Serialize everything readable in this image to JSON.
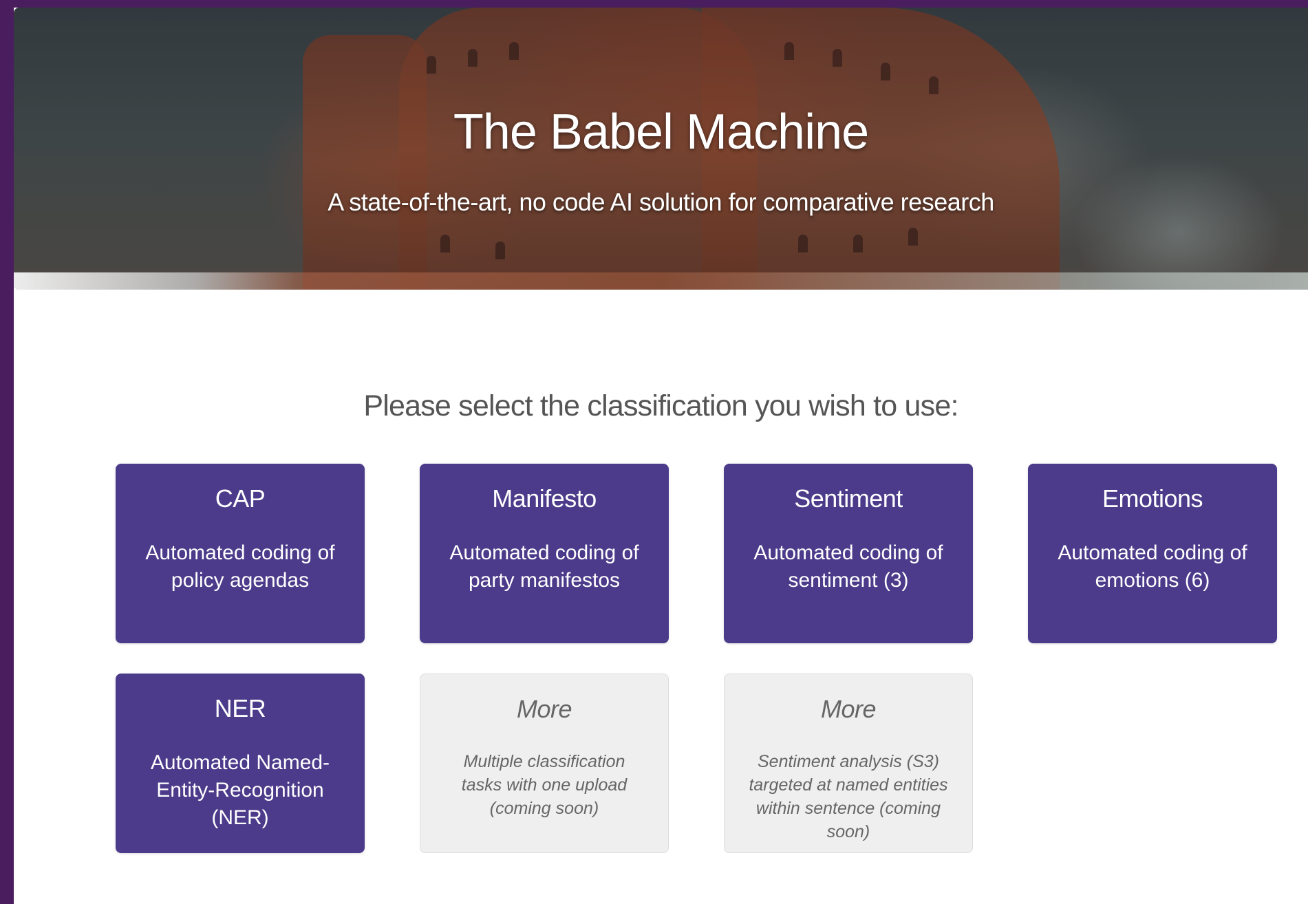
{
  "hero": {
    "title": "The Babel Machine",
    "subtitle": "A state-of-the-art, no code AI solution for comparative research"
  },
  "prompt": "Please select the classification you wish to use:",
  "cards": [
    {
      "title": "CAP",
      "description": "Automated coding of policy agendas",
      "enabled": true
    },
    {
      "title": "Manifesto",
      "description": "Automated coding of party manifestos",
      "enabled": true
    },
    {
      "title": "Sentiment",
      "description": "Automated coding of sentiment (3)",
      "enabled": true
    },
    {
      "title": "Emotions",
      "description": "Automated coding of emotions (6)",
      "enabled": true
    },
    {
      "title": "NER",
      "description": "Automated Named-Entity-Recognition (NER)",
      "enabled": true
    },
    {
      "title": "More",
      "description": "Multiple classification tasks with one upload (coming soon)",
      "enabled": false
    },
    {
      "title": "More",
      "description": "Sentiment analysis (S3) targeted at named entities within sentence (coming soon)",
      "enabled": false
    }
  ],
  "colors": {
    "outer_background": "#4a1d5e",
    "card_active": "#4b3b8a",
    "card_disabled": "#efefef",
    "prompt_text": "#555555"
  }
}
